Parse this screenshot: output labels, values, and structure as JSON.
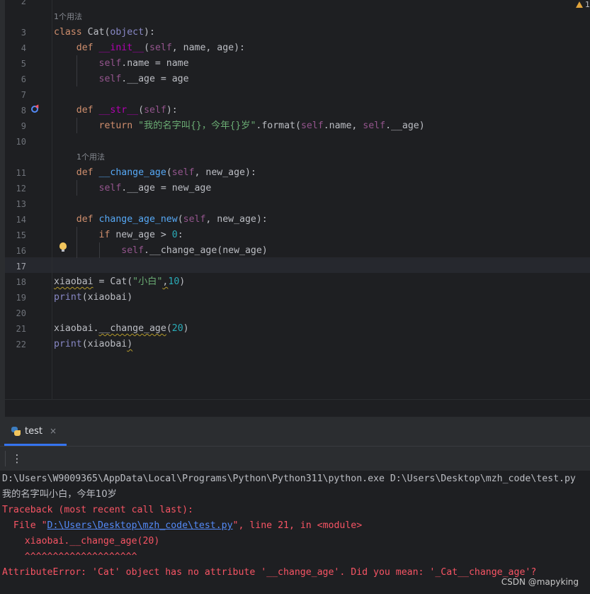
{
  "editor": {
    "inspections": {
      "count": "1"
    },
    "usage_hint_1": "1个用法",
    "usage_hint_2": "1个用法",
    "lines": [
      {
        "n": "2",
        "tokens": []
      },
      {
        "n": "3",
        "tokens": [
          [
            "kw",
            "class "
          ],
          [
            "",
            "Cat("
          ],
          [
            "bi",
            "object"
          ],
          [
            "",
            "):"
          ]
        ]
      },
      {
        "n": "4",
        "tokens": [
          [
            "kw",
            "    def "
          ],
          [
            "ds",
            "__init__"
          ],
          [
            "",
            "("
          ],
          [
            "sf",
            "self"
          ],
          [
            "",
            ", name, age):"
          ]
        ]
      },
      {
        "n": "5",
        "tokens": [
          [
            "sf",
            "        self"
          ],
          [
            "",
            ".name = name"
          ]
        ]
      },
      {
        "n": "6",
        "tokens": [
          [
            "sf",
            "        self"
          ],
          [
            "",
            ".__age = age"
          ]
        ]
      },
      {
        "n": "7",
        "tokens": []
      },
      {
        "n": "8",
        "tokens": [
          [
            "kw",
            "    def "
          ],
          [
            "ds",
            "__str__"
          ],
          [
            "",
            "("
          ],
          [
            "sf",
            "self"
          ],
          [
            "",
            "):"
          ]
        ]
      },
      {
        "n": "9",
        "tokens": [
          [
            "kw",
            "        return "
          ],
          [
            "st",
            "\"我的名字叫{}，今年{}岁\""
          ],
          [
            "",
            ".format("
          ],
          [
            "sf",
            "self"
          ],
          [
            "",
            ".name, "
          ],
          [
            "sf",
            "self"
          ],
          [
            "",
            ".__age)"
          ]
        ]
      },
      {
        "n": "10",
        "tokens": []
      },
      {
        "n": "11",
        "tokens": [
          [
            "kw",
            "    def "
          ],
          [
            "fn",
            "__change_age"
          ],
          [
            "",
            "("
          ],
          [
            "sf",
            "self"
          ],
          [
            "",
            ", new_age):"
          ]
        ]
      },
      {
        "n": "12",
        "tokens": [
          [
            "sf",
            "        self"
          ],
          [
            "",
            ".__age = new_age"
          ]
        ]
      },
      {
        "n": "13",
        "tokens": []
      },
      {
        "n": "14",
        "tokens": [
          [
            "kw",
            "    def "
          ],
          [
            "fn",
            "change_age_new"
          ],
          [
            "",
            "("
          ],
          [
            "sf",
            "self"
          ],
          [
            "",
            ", new_age):"
          ]
        ]
      },
      {
        "n": "15",
        "tokens": [
          [
            "kw",
            "        if "
          ],
          [
            "",
            "new_age > "
          ],
          [
            "nu",
            "0"
          ],
          [
            "",
            ":"
          ]
        ]
      },
      {
        "n": "16",
        "tokens": [
          [
            "sf",
            "            self"
          ],
          [
            "",
            ".__change_age(new_age)"
          ]
        ]
      },
      {
        "n": "17",
        "tokens": []
      },
      {
        "n": "18",
        "tokens": [
          [
            "wv",
            "xiaobai"
          ],
          [
            "",
            " = Cat("
          ],
          [
            "st",
            "\"小白\""
          ],
          [
            "wv",
            ","
          ],
          [
            "nu",
            "10"
          ],
          [
            "",
            ")"
          ]
        ]
      },
      {
        "n": "19",
        "tokens": [
          [
            "bi",
            "print"
          ],
          [
            "",
            "(xiaobai)"
          ]
        ]
      },
      {
        "n": "20",
        "tokens": []
      },
      {
        "n": "21",
        "tokens": [
          [
            "",
            "xiaobai."
          ],
          [
            "wv",
            "__change_age"
          ],
          [
            "",
            "("
          ],
          [
            "nu",
            "20"
          ],
          [
            "",
            ")"
          ]
        ]
      },
      {
        "n": "22",
        "tokens": [
          [
            "bi",
            "print"
          ],
          [
            "",
            "(xiaobai"
          ],
          [
            "wv",
            ")"
          ]
        ]
      }
    ]
  },
  "run_panel": {
    "tab_label": "test",
    "tab_close": "×",
    "more_label": "⋮",
    "console": [
      {
        "kind": "norm",
        "parts": [
          [
            "norm",
            "D:\\Users\\W9009365\\AppData\\Local\\Programs\\Python\\Python311\\python.exe D:\\Users\\Desktop\\mzh_code\\test.py"
          ]
        ]
      },
      {
        "kind": "norm",
        "parts": [
          [
            "cjk",
            "我的名字叫小白，今年10岁"
          ]
        ]
      },
      {
        "kind": "err",
        "parts": [
          [
            "err",
            "Traceback (most recent call last):"
          ]
        ]
      },
      {
        "kind": "err",
        "parts": [
          [
            "err",
            "  File \""
          ],
          [
            "link",
            "D:\\Users\\Desktop\\mzh_code\\test.py"
          ],
          [
            "err",
            "\", line 21, in <module>"
          ]
        ]
      },
      {
        "kind": "err",
        "parts": [
          [
            "err",
            "    xiaobai.__change_age(20)"
          ]
        ]
      },
      {
        "kind": "err",
        "parts": [
          [
            "err",
            "    ^^^^^^^^^^^^^^^^^^^^"
          ]
        ]
      },
      {
        "kind": "err",
        "parts": [
          [
            "err",
            "AttributeError: 'Cat' object has no attribute '__change_age'. Did you mean: '_Cat__change_age'?"
          ]
        ]
      }
    ]
  },
  "watermark": "CSDN @mapyking"
}
